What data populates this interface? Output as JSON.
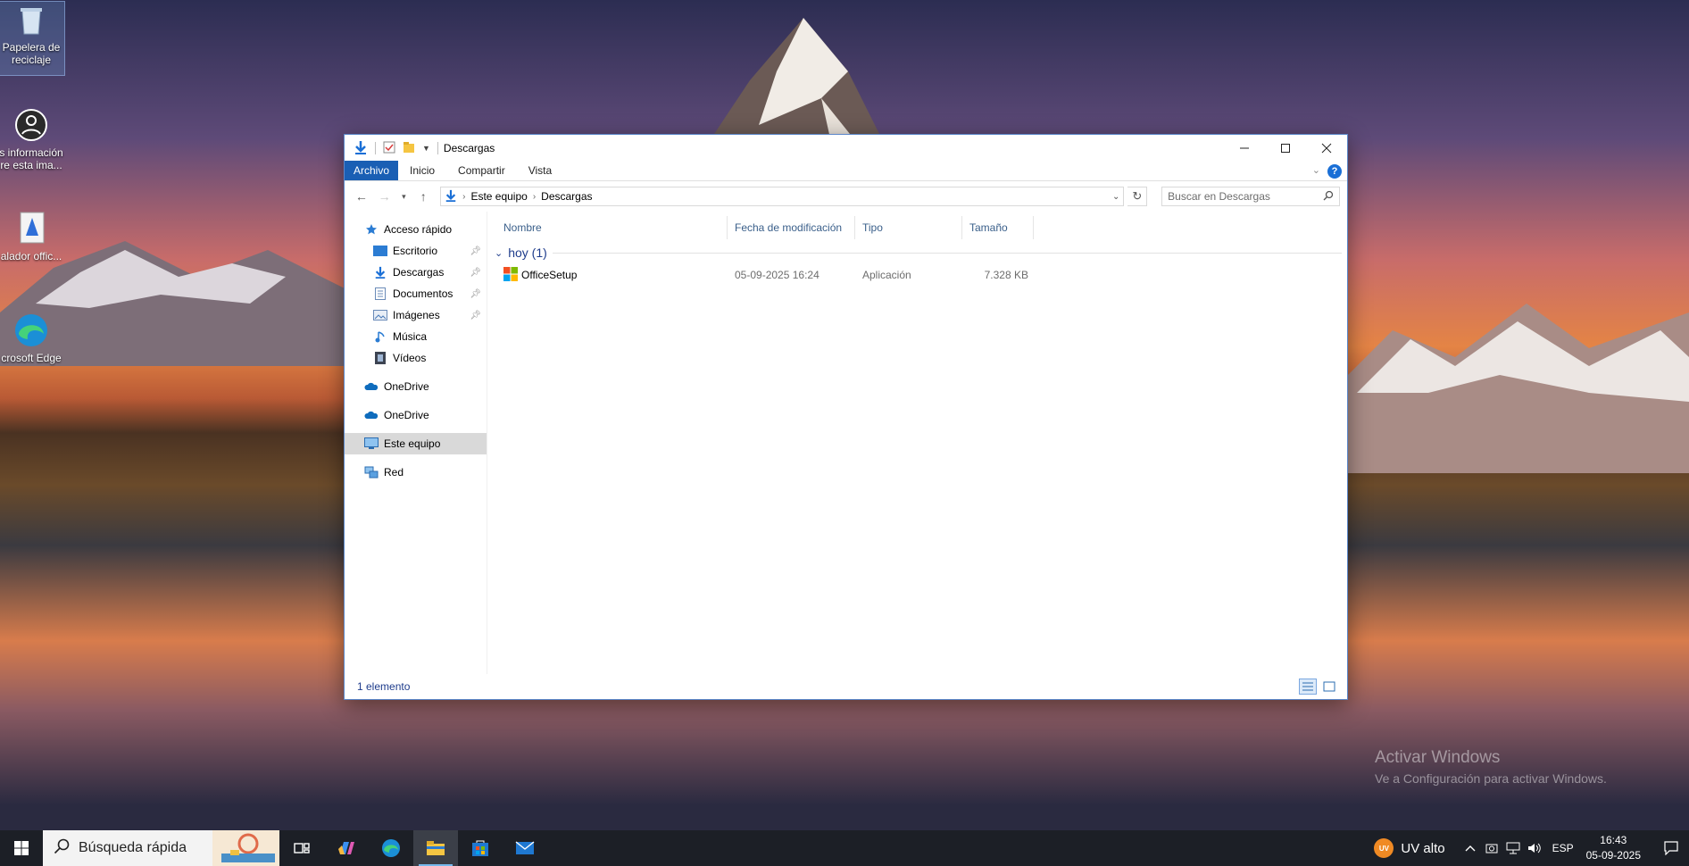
{
  "desktop": {
    "icons": [
      {
        "label": "Papelera de reciclaje",
        "icon": "recycle-bin-icon"
      },
      {
        "label": "s información re esta ima...",
        "icon": "info-icon"
      },
      {
        "label": "alador offic...",
        "icon": "installer-icon"
      },
      {
        "label": "crosoft Edge",
        "icon": "edge-icon"
      }
    ],
    "watermark": {
      "title": "Activar Windows",
      "subtitle": "Ve a Configuración para activar Windows."
    }
  },
  "window": {
    "title": "Descargas",
    "ribbon_tabs": [
      "Archivo",
      "Inicio",
      "Compartir",
      "Vista"
    ],
    "address": {
      "crumbs": [
        "Este equipo",
        "Descargas"
      ]
    },
    "search_placeholder": "Buscar en Descargas",
    "nav": {
      "quick_access": "Acceso rápido",
      "quick_items": [
        {
          "label": "Escritorio",
          "icon": "desktop-folder-icon",
          "pinned": true
        },
        {
          "label": "Descargas",
          "icon": "downloads-icon",
          "pinned": true
        },
        {
          "label": "Documentos",
          "icon": "documents-icon",
          "pinned": true
        },
        {
          "label": "Imágenes",
          "icon": "pictures-icon",
          "pinned": true
        },
        {
          "label": "Música",
          "icon": "music-icon",
          "pinned": false
        },
        {
          "label": "Vídeos",
          "icon": "videos-icon",
          "pinned": false
        }
      ],
      "onedrive1": "OneDrive",
      "onedrive2": "OneDrive",
      "this_pc": "Este equipo",
      "network": "Red"
    },
    "columns": [
      "Nombre",
      "Fecha de modificación",
      "Tipo",
      "Tamaño"
    ],
    "group": "hoy (1)",
    "files": [
      {
        "name": "OfficeSetup",
        "modified": "05-09-2025 16:24",
        "type": "Aplicación",
        "size": "7.328 KB"
      }
    ],
    "status": "1 elemento"
  },
  "taskbar": {
    "search_placeholder": "Búsqueda rápida",
    "weather": {
      "badge": "UV",
      "text": "UV alto"
    },
    "lang": "ESP",
    "time": "16:43",
    "date": "05-09-2025"
  },
  "colors": {
    "accent": "#1a5fb4",
    "taskbar": "#1c1f26",
    "nav_selected": "#d9d9d9"
  }
}
